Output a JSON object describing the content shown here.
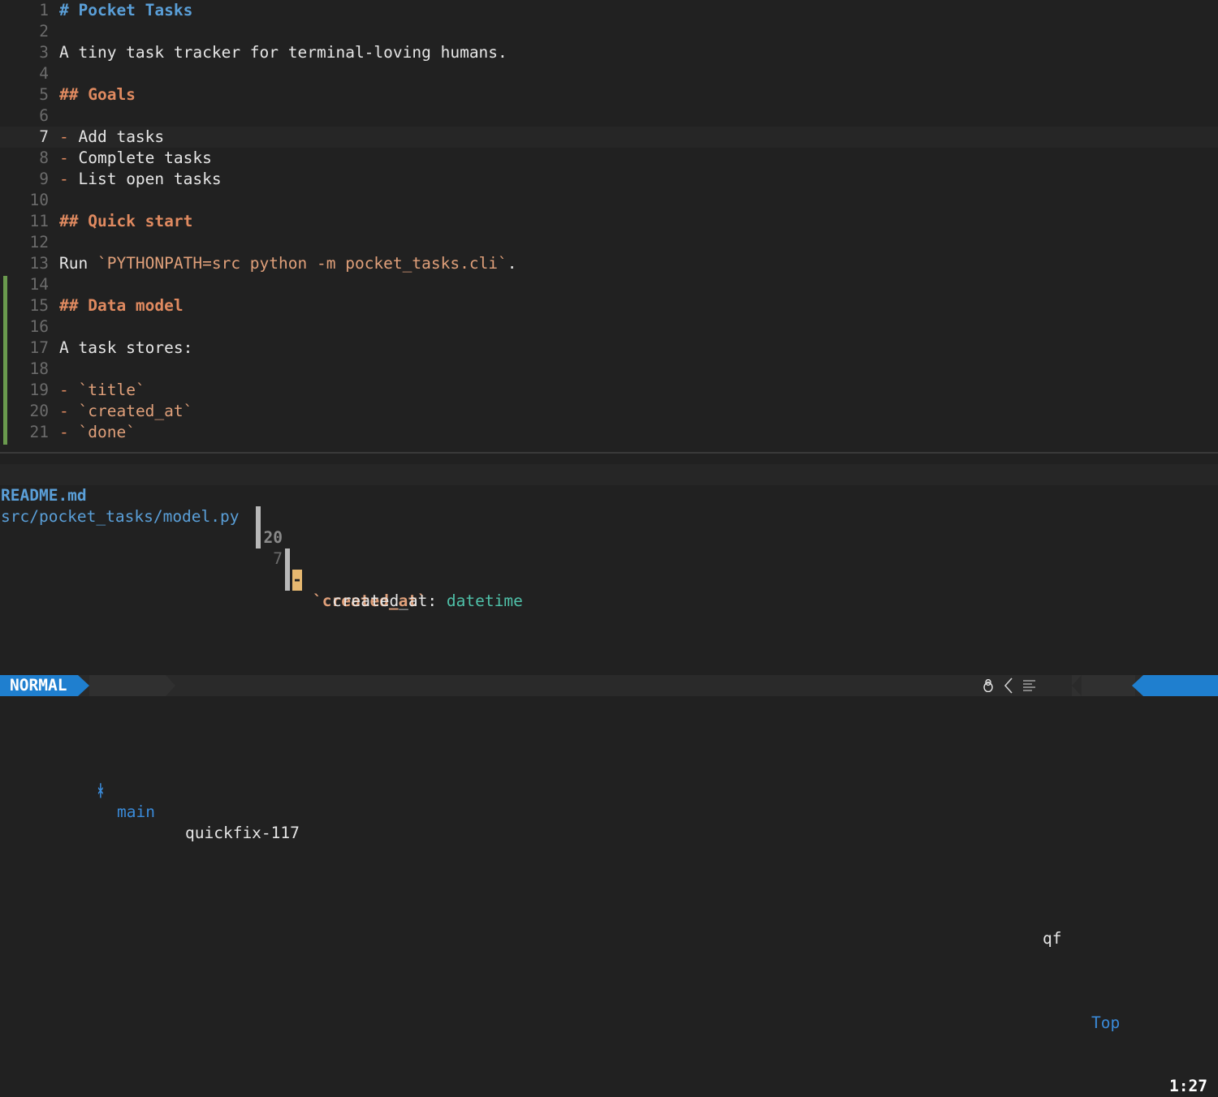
{
  "editor": {
    "lines": [
      {
        "num": "1",
        "segments": [
          {
            "text": "# Pocket Tasks",
            "cls": "h1"
          }
        ]
      },
      {
        "num": "2",
        "segments": []
      },
      {
        "num": "3",
        "segments": [
          {
            "text": "A tiny task tracker for terminal-loving humans.",
            "cls": ""
          }
        ]
      },
      {
        "num": "4",
        "segments": []
      },
      {
        "num": "5",
        "segments": [
          {
            "text": "## Goals",
            "cls": "h2"
          }
        ]
      },
      {
        "num": "6",
        "segments": []
      },
      {
        "num": "7",
        "segments": [
          {
            "text": "-",
            "cls": "dash"
          },
          {
            "text": " Add tasks",
            "cls": ""
          }
        ],
        "current": true
      },
      {
        "num": "8",
        "segments": [
          {
            "text": "-",
            "cls": "dash"
          },
          {
            "text": " Complete tasks",
            "cls": ""
          }
        ]
      },
      {
        "num": "9",
        "segments": [
          {
            "text": "-",
            "cls": "dash"
          },
          {
            "text": " List open tasks",
            "cls": ""
          }
        ]
      },
      {
        "num": "10",
        "segments": []
      },
      {
        "num": "11",
        "segments": [
          {
            "text": "## Quick start",
            "cls": "h2"
          }
        ]
      },
      {
        "num": "12",
        "segments": []
      },
      {
        "num": "13",
        "segments": [
          {
            "text": "Run ",
            "cls": ""
          },
          {
            "text": "`PYTHONPATH=src python -m pocket_tasks.cli`",
            "cls": "code"
          },
          {
            "text": ".",
            "cls": ""
          }
        ]
      },
      {
        "num": "14",
        "segments": []
      },
      {
        "num": "15",
        "segments": [
          {
            "text": "## Data model",
            "cls": "h2"
          }
        ]
      },
      {
        "num": "16",
        "segments": []
      },
      {
        "num": "17",
        "segments": [
          {
            "text": "A task stores:",
            "cls": ""
          }
        ]
      },
      {
        "num": "18",
        "segments": []
      },
      {
        "num": "19",
        "segments": [
          {
            "text": "-",
            "cls": "dash"
          },
          {
            "text": " ",
            "cls": ""
          },
          {
            "text": "`title`",
            "cls": "code"
          }
        ]
      },
      {
        "num": "20",
        "segments": [
          {
            "text": "-",
            "cls": "dash"
          },
          {
            "text": " ",
            "cls": ""
          },
          {
            "text": "`created_at`",
            "cls": "code"
          }
        ]
      },
      {
        "num": "21",
        "segments": [
          {
            "text": "-",
            "cls": "dash"
          },
          {
            "text": " ",
            "cls": ""
          },
          {
            "text": "`done`",
            "cls": "code"
          }
        ]
      }
    ]
  },
  "quickfix": {
    "rows": [
      {
        "file": "README.md",
        "lnum": "20",
        "cursor": "-",
        "text": "`created_at`",
        "kind": "readme"
      },
      {
        "file": "src/pocket_tasks/model.py",
        "lnum": "7",
        "ident": "created_at",
        "colon": ":",
        "type": "datetime",
        "kind": "py"
      }
    ]
  },
  "status": {
    "mode": "NORMAL",
    "branch_icon": "git-branch-icon",
    "branch": "main",
    "filename": "quickfix-117",
    "os_icon": "linux-tux-icon",
    "filetype": "qf",
    "position": "Top",
    "line_col": "1:27"
  },
  "colors": {
    "background": "#212121",
    "heading1": "#5a9fd8",
    "heading2": "#e08a60",
    "inline_code": "#e0a07a",
    "mode_bg": "#1f7fcf",
    "git_added": "#6a9a4e",
    "type": "#4fc0a8"
  }
}
